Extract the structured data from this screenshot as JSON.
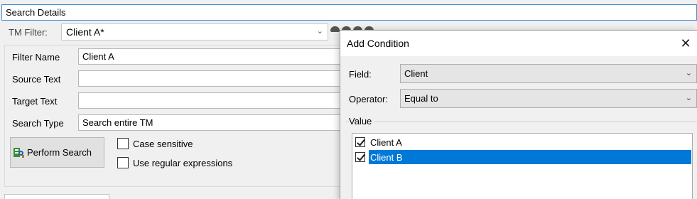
{
  "header": {
    "title": "Search Details"
  },
  "tm_filter": {
    "label": "TM Filter:",
    "value": "Client A*"
  },
  "filter_form": {
    "filter_name": {
      "label": "Filter Name",
      "value": "Client A"
    },
    "source_text": {
      "label": "Source Text",
      "value": ""
    },
    "target_text": {
      "label": "Target Text",
      "value": ""
    },
    "search_type": {
      "label": "Search Type",
      "value": "Search entire TM"
    }
  },
  "actions": {
    "perform_search": "Perform Search"
  },
  "options": {
    "case_sensitive": {
      "label": "Case sensitive",
      "checked": false
    },
    "regex": {
      "label": "Use regular expressions",
      "checked": false
    }
  },
  "dialog": {
    "title": "Add Condition",
    "field": {
      "label": "Field:",
      "value": "Client"
    },
    "operator": {
      "label": "Operator:",
      "value": "Equal to"
    },
    "value_group_label": "Value",
    "values": [
      {
        "label": "Client A",
        "checked": true,
        "selected": false
      },
      {
        "label": "Client B",
        "checked": true,
        "selected": true
      }
    ]
  },
  "colors": {
    "selection": "#0078d7",
    "focus_border": "#3f8fd6"
  }
}
